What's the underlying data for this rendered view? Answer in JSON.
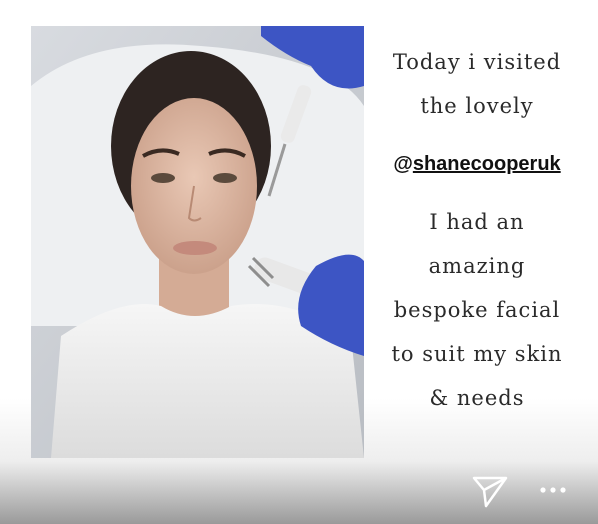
{
  "story": {
    "caption": {
      "line1": "Today i visited",
      "line2": "the lovely",
      "mention_at": "@",
      "mention_handle": "shanecooperuk",
      "line4": "I had an",
      "line5": "amazing",
      "line6": "bespoke facial",
      "line7": "to suit my skin",
      "line8": "& needs"
    },
    "photo": {
      "subject": "woman-face",
      "icons": [
        "glove",
        "facial-tool"
      ]
    },
    "controls": {
      "send_icon": "send-icon",
      "more_icon": "more-options-icon"
    },
    "colors": {
      "glove": "#3d55c4",
      "caption_text": "#2a2a2a"
    }
  }
}
